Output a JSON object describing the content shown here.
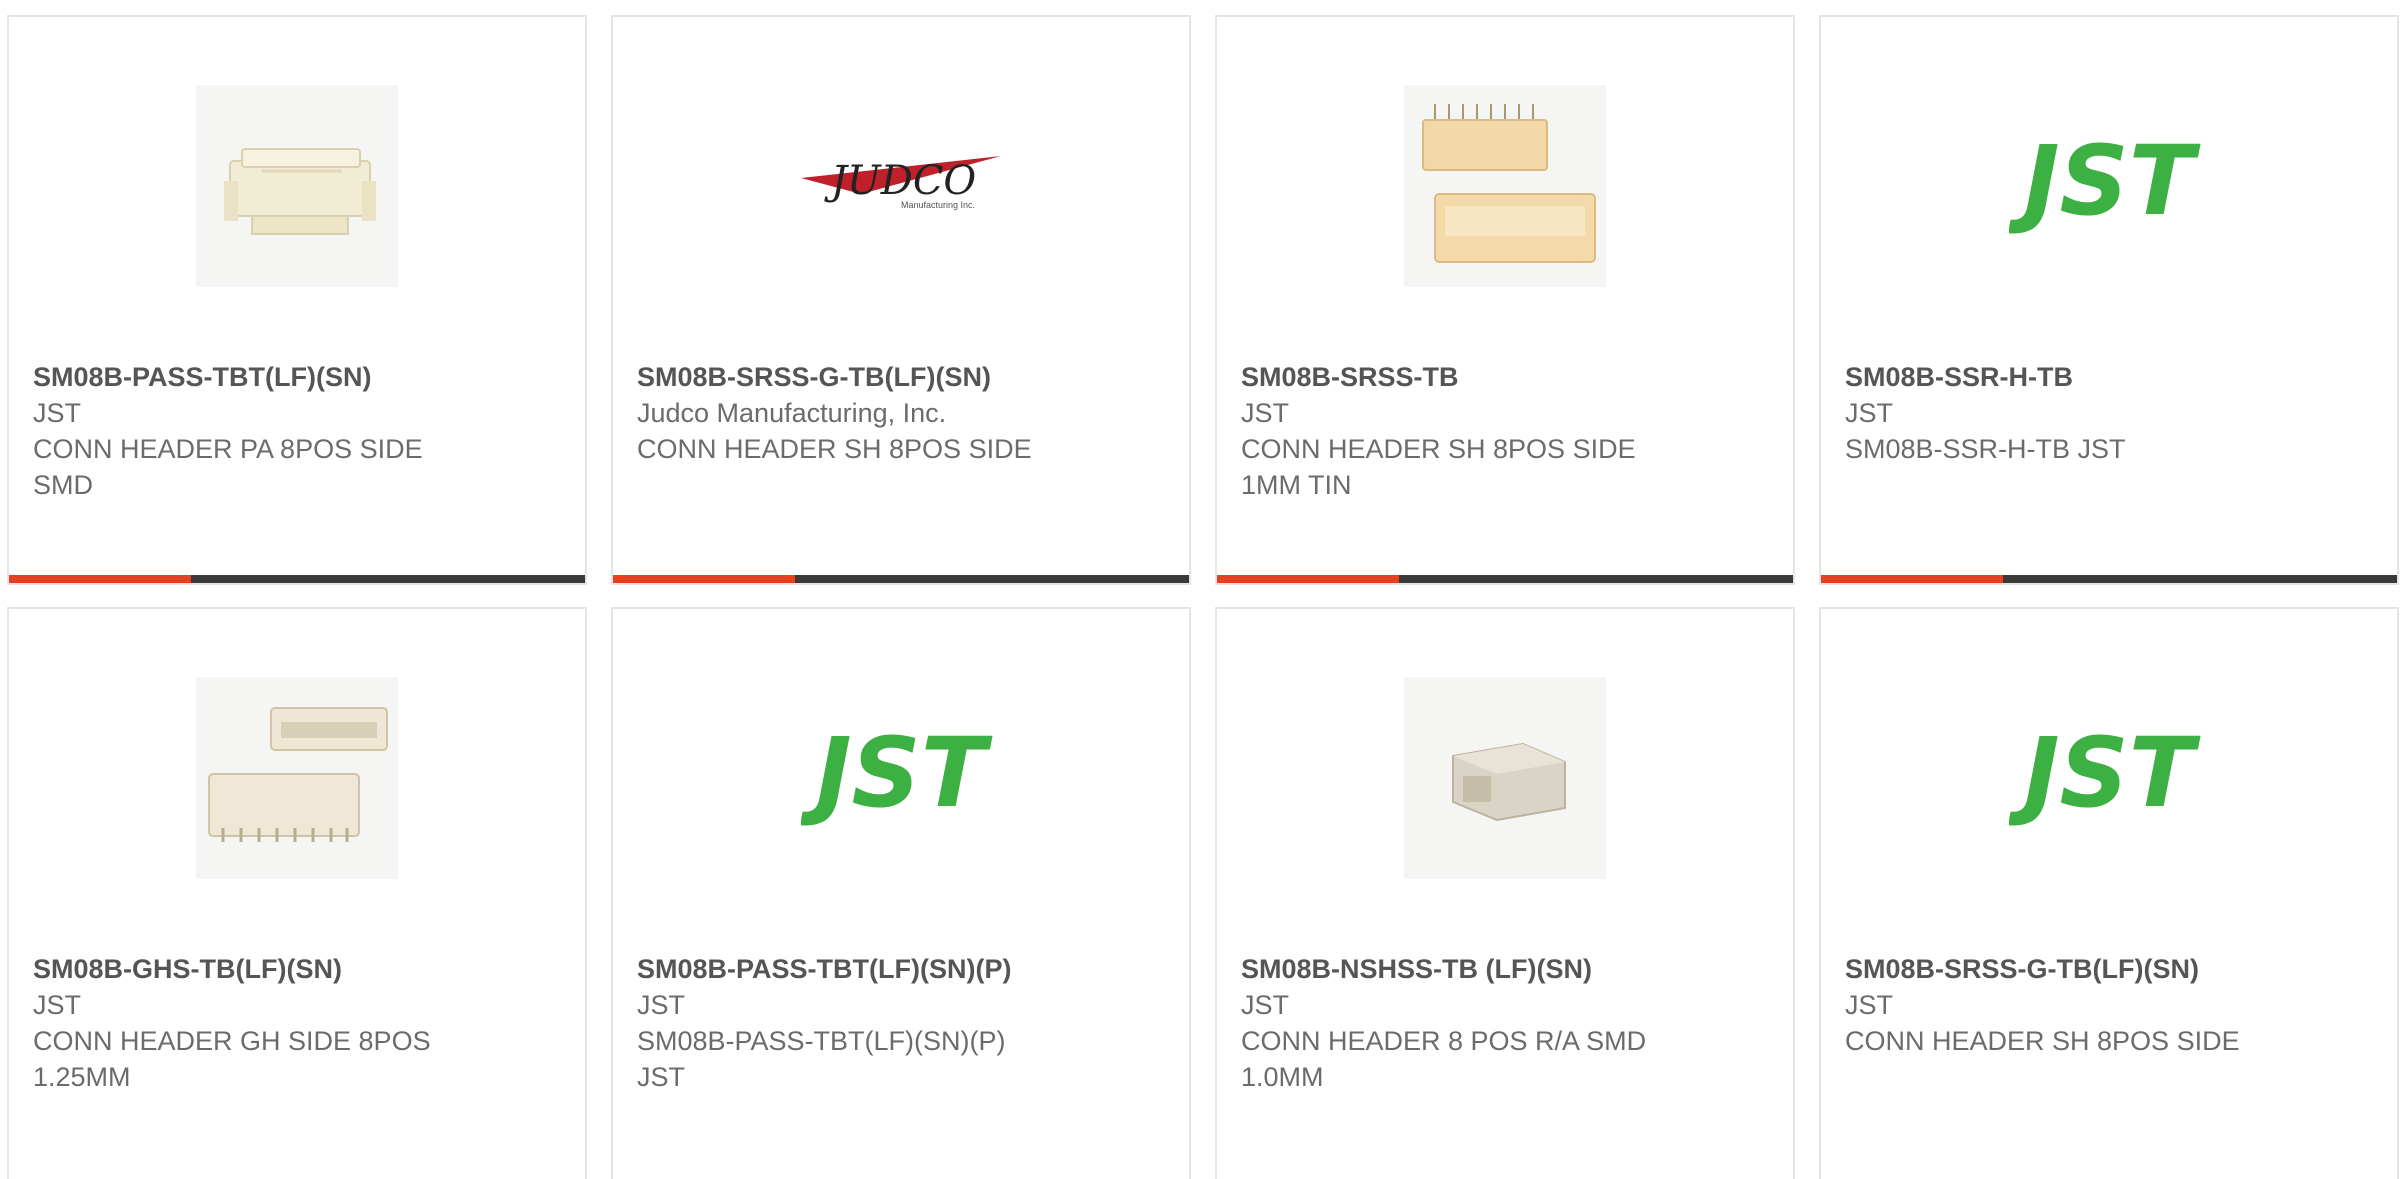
{
  "colors": {
    "accent_bar": "#e8401c",
    "dark_bar": "#3a3a3a",
    "jst_green": "#3cb043",
    "judco_red": "#c0202a"
  },
  "products": [
    {
      "part_number": "SM08B-PASS-TBT(LF)(SN)",
      "manufacturer": "JST",
      "description": "CONN HEADER PA 8POS SIDE SMD",
      "image": "connector-photo"
    },
    {
      "part_number": "SM08B-SRSS-G-TB(LF)(SN)",
      "manufacturer": "Judco Manufacturing, Inc.",
      "description": "CONN HEADER SH 8POS SIDE",
      "image": "judco-logo",
      "logo_text": "JUDCO",
      "logo_subtext": "Manufacturing Inc."
    },
    {
      "part_number": "SM08B-SRSS-TB",
      "manufacturer": "JST",
      "description": "CONN HEADER SH 8POS SIDE 1MM TIN",
      "image": "connector-photo"
    },
    {
      "part_number": "SM08B-SSR-H-TB",
      "manufacturer": "JST",
      "description": "SM08B-SSR-H-TB JST",
      "image": "jst-logo",
      "logo_text": "JST"
    },
    {
      "part_number": "SM08B-GHS-TB(LF)(SN)",
      "manufacturer": "JST",
      "description": "CONN HEADER GH SIDE 8POS 1.25MM",
      "image": "connector-photo"
    },
    {
      "part_number": "SM08B-PASS-TBT(LF)(SN)(P)",
      "manufacturer": "JST",
      "description": "SM08B-PASS-TBT(LF)(SN)(P) JST",
      "image": "jst-logo",
      "logo_text": "JST"
    },
    {
      "part_number": "SM08B-NSHSS-TB (LF)(SN)",
      "manufacturer": "JST",
      "description": "CONN HEADER 8 POS R/A SMD 1.0MM",
      "image": "connector-photo"
    },
    {
      "part_number": "SM08B-SRSS-G-TB(LF)(SN)",
      "manufacturer": "JST",
      "description": "CONN HEADER SH 8POS SIDE",
      "image": "jst-logo",
      "logo_text": "JST"
    }
  ]
}
